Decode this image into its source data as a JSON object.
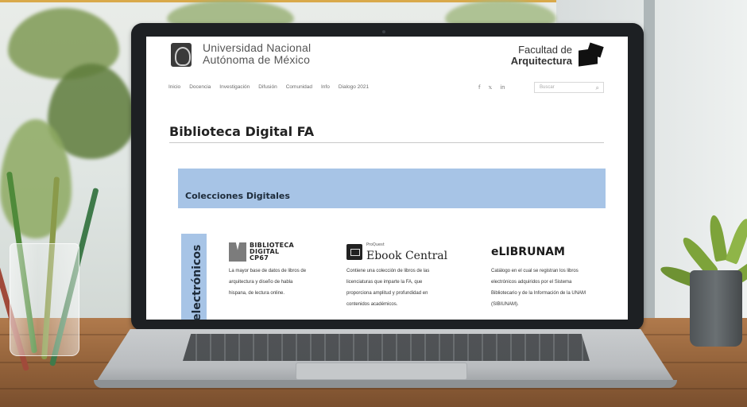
{
  "site": {
    "unam_line1": "Universidad Nacional",
    "unam_line2": "Autónoma de México",
    "faculty_line1": "Facultad de",
    "faculty_line2": "Arquitectura"
  },
  "nav": {
    "items": [
      "Inicio",
      "Docencia",
      "Investigación",
      "Difusión",
      "Comunidad",
      "Info",
      "Dialogo 2021"
    ],
    "social": [
      "f",
      "𝕩",
      "in"
    ],
    "search_placeholder": "Buscar"
  },
  "page": {
    "title": "Biblioteca Digital FA",
    "section_band": "Colecciones Digitales",
    "side_tab": "electrónicos"
  },
  "collections": [
    {
      "logo_text_1": "BIBLIOTECA",
      "logo_text_2": "DIGITAL",
      "logo_text_3": "CP67",
      "lines": [
        "La mayor base de datos de libros de",
        "arquitectura y diseño de habla",
        "hispana, de lectura online."
      ]
    },
    {
      "logo_small": "ProQuest",
      "logo_text": "Ebook Central",
      "lines": [
        "Contiene una colección de libros de las",
        "licenciaturas que imparte la FA, que",
        "proporciona amplitud y profundidad en",
        "contenidos académicos."
      ]
    },
    {
      "logo_text": "eLIBRUNAM",
      "lines": [
        "Catálogo en el cual se registran los libros",
        "electrónicos adquiridos por el Sistema",
        "Bibliotecario y de la Información de la UNAM",
        "(SIBIUNAM)."
      ]
    }
  ]
}
